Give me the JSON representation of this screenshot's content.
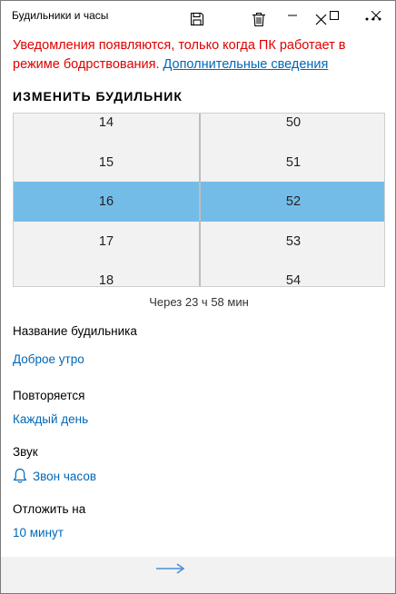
{
  "window": {
    "title": "Будильники и часы"
  },
  "notice": {
    "text": "Уведомления появляются, только когда ПК работает в режиме бодрствования.",
    "link": "Дополнительные сведения"
  },
  "section_title": "ИЗМЕНИТЬ БУДИЛЬНИК",
  "picker": {
    "hours": [
      "14",
      "15",
      "16",
      "17",
      "18"
    ],
    "minutes": [
      "50",
      "51",
      "52",
      "53",
      "54"
    ],
    "selected_hour": "16",
    "selected_minute": "52"
  },
  "remaining": "Через 23 ч 58 мин",
  "fields": {
    "name_label": "Название будильника",
    "name_value": "Доброе утро",
    "repeat_label": "Повторяется",
    "repeat_value": "Каждый день",
    "sound_label": "Звук",
    "sound_value": "Звон часов",
    "snooze_label": "Отложить на",
    "snooze_value": "10 минут"
  },
  "icons": {
    "minimize": "minimize-icon",
    "maximize": "maximize-icon",
    "close": "close-icon",
    "bell": "bell-icon",
    "save": "save-icon",
    "delete": "trash-icon",
    "cancel": "close-icon",
    "more": "more-icon",
    "arrow": "arrow-right-icon"
  },
  "colors": {
    "notice": "#e00000",
    "accent": "#0067b8",
    "selection": "#74bce8",
    "command_bar": "#f2f2f2"
  }
}
